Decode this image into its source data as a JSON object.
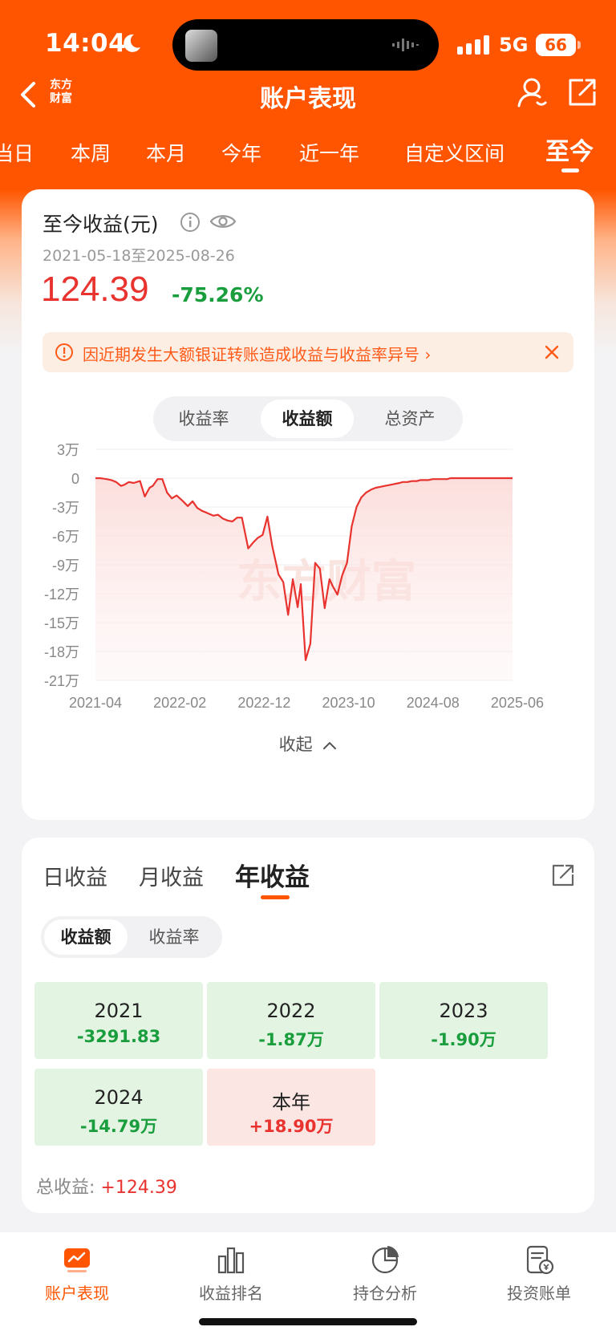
{
  "status_bar": {
    "time": "14:04",
    "network": "5G",
    "battery": "66"
  },
  "nav": {
    "title": "账户表现",
    "logo_line1": "东方",
    "logo_line2": "财富"
  },
  "period_tabs": [
    {
      "label": "当日"
    },
    {
      "label": "本周"
    },
    {
      "label": "本月"
    },
    {
      "label": "今年"
    },
    {
      "label": "近一年"
    },
    {
      "label": "自定义区间"
    },
    {
      "label": "至今"
    }
  ],
  "summary": {
    "title": "至今收益(元)",
    "date_range": "2021-05-18至2025-08-26",
    "amount": "124.39",
    "rate": "-75.26%",
    "notice": "因近期发生大额银证转账造成收益与收益率异号 ›",
    "segments": [
      "收益率",
      "收益额",
      "总资产"
    ],
    "active_segment": "收益额",
    "collapse_label": "收起"
  },
  "chart_data": {
    "type": "area",
    "watermark": "东方财富",
    "y_tick_labels": [
      "3万",
      "0",
      "-3万",
      "-6万",
      "-9万",
      "-12万",
      "-15万",
      "-18万",
      "-21万"
    ],
    "x_tick_labels": [
      "2021-04",
      "2022-02",
      "2022-12",
      "2023-10",
      "2024-08",
      "2025-06"
    ],
    "ylim": [
      -21,
      3
    ],
    "y_unit": "万",
    "grid": true,
    "series": [
      {
        "color": "#e8332f",
        "x": [
          0,
          0.6,
          1.4,
          2.0,
          2.6,
          3.2,
          3.6,
          4.2,
          4.8,
          5.6,
          6.2,
          6.8,
          7.2,
          7.8,
          8.4,
          9.0,
          9.6,
          10.2,
          10.6,
          11.0,
          11.6,
          12.2,
          12.8,
          13.4,
          14.0,
          14.8,
          15.4,
          16.0,
          16.6,
          17.2,
          17.8,
          18.4,
          19.2,
          19.8,
          20.4,
          21.0,
          21.6,
          22.2,
          23.0,
          23.6,
          24.2,
          24.8,
          25.4,
          25.8,
          26.4,
          27.0,
          27.6,
          28.2,
          28.8,
          29.4,
          29.8,
          30.4,
          31.0,
          31.6,
          32.2,
          32.8,
          33.4,
          34.0,
          34.6,
          35.2,
          35.8,
          36.4,
          37.0,
          37.6,
          38.2,
          38.6,
          39.2,
          39.8,
          40.4,
          40.8,
          41.4,
          41.8,
          42.4,
          42.8,
          43.4,
          43.8,
          44.2,
          44.6,
          45.2,
          45.8,
          46.4,
          46.8,
          47.2,
          47.6,
          48.2,
          48.8,
          49.2,
          49.6,
          50.2,
          50.8,
          51.4,
          52.0,
          52.4
        ],
        "values": [
          0,
          0,
          -0.1,
          -0.2,
          -0.4,
          -0.8,
          -0.7,
          -0.4,
          -0.5,
          -0.3,
          -1.9,
          -1.0,
          -0.8,
          -0.1,
          -0.1,
          -1.5,
          -2.1,
          -1.8,
          -2.1,
          -2.4,
          -2.9,
          -2.4,
          -3.1,
          -3.4,
          -3.6,
          -3.9,
          -3.8,
          -4.2,
          -4.4,
          -4.5,
          -4.1,
          -4.1,
          -7.3,
          -6.7,
          -6.2,
          -5.9,
          -4.0,
          -7.0,
          -10.0,
          -10.8,
          -14.2,
          -10.5,
          -13.4,
          -11.0,
          -18.9,
          -17.2,
          -8.8,
          -9.4,
          -13.5,
          -10.5,
          -11.2,
          -12.1,
          -10.1,
          -8.8,
          -5.0,
          -3.0,
          -2.0,
          -1.5,
          -1.2,
          -1.0,
          -0.9,
          -0.8,
          -0.7,
          -0.6,
          -0.5,
          -0.4,
          -0.4,
          -0.3,
          -0.3,
          -0.2,
          -0.2,
          -0.2,
          -0.1,
          -0.1,
          -0.1,
          -0.1,
          -0.1,
          0,
          0,
          0,
          0,
          0,
          0,
          0,
          0,
          0,
          0,
          0,
          0,
          0,
          0,
          0,
          0
        ]
      }
    ]
  },
  "returns": {
    "tabs": [
      "日收益",
      "月收益",
      "年收益"
    ],
    "active_tab": "年收益",
    "segments": [
      "收益额",
      "收益率"
    ],
    "active_segment": "收益额",
    "cells": [
      {
        "year": "2021",
        "value": "-3291.83",
        "tone": "green"
      },
      {
        "year": "2022",
        "value": "-1.87万",
        "tone": "green"
      },
      {
        "year": "2023",
        "value": "-1.90万",
        "tone": "green"
      },
      {
        "year": "2024",
        "value": "-14.79万",
        "tone": "green"
      },
      {
        "year": "本年",
        "value": "+18.90万",
        "tone": "red"
      }
    ],
    "total_label": "总收益:",
    "total_value": "+124.39"
  },
  "bottom_nav": [
    {
      "label": "账户表现",
      "icon": "chart-trend-icon"
    },
    {
      "label": "收益排名",
      "icon": "bar-chart-icon"
    },
    {
      "label": "持仓分析",
      "icon": "pie-chart-icon"
    },
    {
      "label": "投资账单",
      "icon": "bill-icon"
    }
  ],
  "colors": {
    "brand": "#ff5500",
    "loss": "#1a9e3d",
    "gain": "#e8332f",
    "notice": "#ff5a18"
  }
}
